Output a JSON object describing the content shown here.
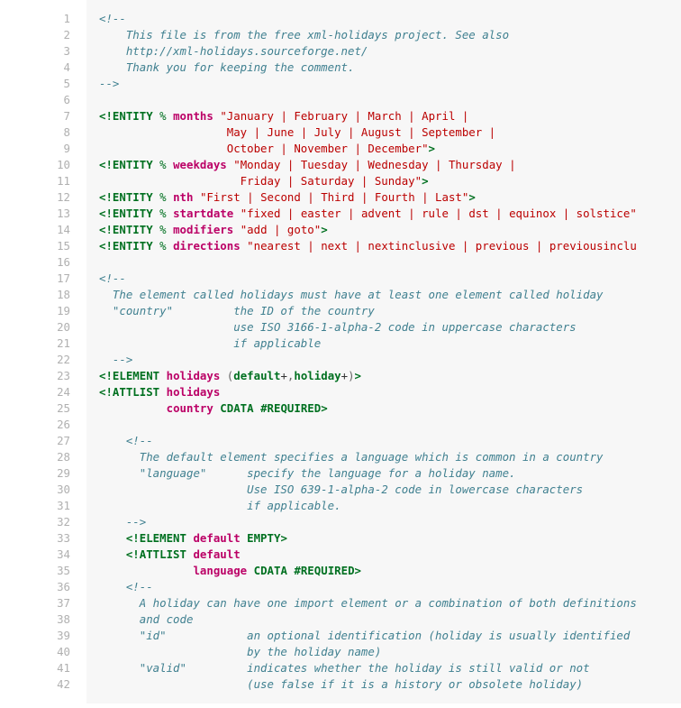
{
  "line_count": 42,
  "lines": [
    {
      "indent": 0,
      "tokens": [
        {
          "cls": "cm",
          "t": "<!--"
        }
      ]
    },
    {
      "indent": 0,
      "tokens": [
        {
          "cls": "cm",
          "t": "    This file is from the free xml-holidays project. See also"
        }
      ]
    },
    {
      "indent": 0,
      "tokens": [
        {
          "cls": "cm",
          "t": "    http://xml-holidays.sourceforge.net/"
        }
      ]
    },
    {
      "indent": 0,
      "tokens": [
        {
          "cls": "cm",
          "t": "    Thank you for keeping the comment."
        }
      ]
    },
    {
      "indent": 0,
      "tokens": [
        {
          "cls": "cm",
          "t": "-->"
        }
      ]
    },
    {
      "indent": 0,
      "tokens": []
    },
    {
      "indent": 0,
      "tokens": [
        {
          "cls": "kw",
          "t": "<!ENTITY "
        },
        {
          "cls": "pd",
          "t": "%"
        },
        {
          "cls": "pl",
          "t": " "
        },
        {
          "cls": "nm",
          "t": "months"
        },
        {
          "cls": "pl",
          "t": " "
        },
        {
          "cls": "st",
          "t": "\"January | February | March | April |"
        }
      ]
    },
    {
      "indent": 0,
      "tokens": [
        {
          "cls": "st",
          "t": "                   May | June | July | August | September |"
        }
      ]
    },
    {
      "indent": 0,
      "tokens": [
        {
          "cls": "st",
          "t": "                   October | November | December\""
        },
        {
          "cls": "kw",
          "t": ">"
        }
      ]
    },
    {
      "indent": 0,
      "tokens": [
        {
          "cls": "kw",
          "t": "<!ENTITY "
        },
        {
          "cls": "pd",
          "t": "%"
        },
        {
          "cls": "pl",
          "t": " "
        },
        {
          "cls": "nm",
          "t": "weekdays"
        },
        {
          "cls": "pl",
          "t": " "
        },
        {
          "cls": "st",
          "t": "\"Monday | Tuesday | Wednesday | Thursday |"
        }
      ]
    },
    {
      "indent": 0,
      "tokens": [
        {
          "cls": "st",
          "t": "                     Friday | Saturday | Sunday\""
        },
        {
          "cls": "kw",
          "t": ">"
        }
      ]
    },
    {
      "indent": 0,
      "tokens": [
        {
          "cls": "kw",
          "t": "<!ENTITY "
        },
        {
          "cls": "pd",
          "t": "%"
        },
        {
          "cls": "pl",
          "t": " "
        },
        {
          "cls": "nm",
          "t": "nth"
        },
        {
          "cls": "pl",
          "t": " "
        },
        {
          "cls": "st",
          "t": "\"First | Second | Third | Fourth | Last\""
        },
        {
          "cls": "kw",
          "t": ">"
        }
      ]
    },
    {
      "indent": 0,
      "tokens": [
        {
          "cls": "kw",
          "t": "<!ENTITY "
        },
        {
          "cls": "pd",
          "t": "%"
        },
        {
          "cls": "pl",
          "t": " "
        },
        {
          "cls": "nm",
          "t": "startdate"
        },
        {
          "cls": "pl",
          "t": " "
        },
        {
          "cls": "st",
          "t": "\"fixed | easter | advent | rule | dst | equinox | solstice\""
        }
      ]
    },
    {
      "indent": 0,
      "tokens": [
        {
          "cls": "kw",
          "t": "<!ENTITY "
        },
        {
          "cls": "pd",
          "t": "%"
        },
        {
          "cls": "pl",
          "t": " "
        },
        {
          "cls": "nm",
          "t": "modifiers"
        },
        {
          "cls": "pl",
          "t": " "
        },
        {
          "cls": "st",
          "t": "\"add | goto\""
        },
        {
          "cls": "kw",
          "t": ">"
        }
      ]
    },
    {
      "indent": 0,
      "tokens": [
        {
          "cls": "kw",
          "t": "<!ENTITY "
        },
        {
          "cls": "pd",
          "t": "%"
        },
        {
          "cls": "pl",
          "t": " "
        },
        {
          "cls": "nm",
          "t": "directions"
        },
        {
          "cls": "pl",
          "t": " "
        },
        {
          "cls": "st",
          "t": "\"nearest | next | nextinclusive | previous | previousinclu"
        }
      ]
    },
    {
      "indent": 0,
      "tokens": []
    },
    {
      "indent": 0,
      "tokens": [
        {
          "cls": "cm",
          "t": "<!--"
        }
      ]
    },
    {
      "indent": 0,
      "tokens": [
        {
          "cls": "cm",
          "t": "  The element called holidays must have at least one element called holiday"
        }
      ]
    },
    {
      "indent": 0,
      "tokens": [
        {
          "cls": "cm",
          "t": "  \"country\"         the ID of the country"
        }
      ]
    },
    {
      "indent": 0,
      "tokens": [
        {
          "cls": "cm",
          "t": "                    use ISO 3166-1-alpha-2 code in uppercase characters"
        }
      ]
    },
    {
      "indent": 0,
      "tokens": [
        {
          "cls": "cm",
          "t": "                    if applicable"
        }
      ]
    },
    {
      "indent": 0,
      "tokens": [
        {
          "cls": "cm",
          "t": "  -->"
        }
      ]
    },
    {
      "indent": 0,
      "tokens": [
        {
          "cls": "kw",
          "t": "<!ELEMENT "
        },
        {
          "cls": "nm",
          "t": "holidays"
        },
        {
          "cls": "pl",
          "t": " "
        },
        {
          "cls": "pg",
          "t": "("
        },
        {
          "cls": "st2",
          "t": "default"
        },
        {
          "cls": "pl",
          "t": "+"
        },
        {
          "cls": "pg",
          "t": ","
        },
        {
          "cls": "st2",
          "t": "holiday"
        },
        {
          "cls": "pl",
          "t": "+"
        },
        {
          "cls": "pg",
          "t": ")"
        },
        {
          "cls": "kw",
          "t": ">"
        }
      ]
    },
    {
      "indent": 0,
      "tokens": [
        {
          "cls": "kw",
          "t": "<!ATTLIST "
        },
        {
          "cls": "nm",
          "t": "holidays"
        }
      ]
    },
    {
      "indent": 0,
      "tokens": [
        {
          "cls": "pl",
          "t": "          "
        },
        {
          "cls": "nm",
          "t": "country"
        },
        {
          "cls": "pl",
          "t": " "
        },
        {
          "cls": "st2",
          "t": "CDATA"
        },
        {
          "cls": "pl",
          "t": " "
        },
        {
          "cls": "st2",
          "t": "#REQUIRED"
        },
        {
          "cls": "kw",
          "t": ">"
        }
      ]
    },
    {
      "indent": 0,
      "tokens": []
    },
    {
      "indent": 1,
      "tokens": [
        {
          "cls": "cm",
          "t": "<!--"
        }
      ]
    },
    {
      "indent": 1,
      "tokens": [
        {
          "cls": "cm",
          "t": "  The default element specifies a language which is common in a country"
        }
      ]
    },
    {
      "indent": 1,
      "tokens": [
        {
          "cls": "cm",
          "t": "  \"language\"      specify the language for a holiday name."
        }
      ]
    },
    {
      "indent": 1,
      "tokens": [
        {
          "cls": "cm",
          "t": "                  Use ISO 639-1-alpha-2 code in lowercase characters"
        }
      ]
    },
    {
      "indent": 1,
      "tokens": [
        {
          "cls": "cm",
          "t": "                  if applicable."
        }
      ]
    },
    {
      "indent": 1,
      "tokens": [
        {
          "cls": "cm",
          "t": "-->"
        }
      ]
    },
    {
      "indent": 1,
      "tokens": [
        {
          "cls": "kw",
          "t": "<!ELEMENT "
        },
        {
          "cls": "nm",
          "t": "default"
        },
        {
          "cls": "pl",
          "t": " "
        },
        {
          "cls": "st2",
          "t": "EMPTY"
        },
        {
          "cls": "kw",
          "t": ">"
        }
      ]
    },
    {
      "indent": 1,
      "tokens": [
        {
          "cls": "kw",
          "t": "<!ATTLIST "
        },
        {
          "cls": "nm",
          "t": "default"
        }
      ]
    },
    {
      "indent": 1,
      "tokens": [
        {
          "cls": "pl",
          "t": "          "
        },
        {
          "cls": "nm",
          "t": "language"
        },
        {
          "cls": "pl",
          "t": " "
        },
        {
          "cls": "st2",
          "t": "CDATA"
        },
        {
          "cls": "pl",
          "t": " "
        },
        {
          "cls": "st2",
          "t": "#REQUIRED"
        },
        {
          "cls": "kw",
          "t": ">"
        }
      ]
    },
    {
      "indent": 1,
      "tokens": [
        {
          "cls": "cm",
          "t": "<!--"
        }
      ]
    },
    {
      "indent": 1,
      "tokens": [
        {
          "cls": "cm",
          "t": "  A holiday can have one import element or a combination of both definitions"
        }
      ]
    },
    {
      "indent": 1,
      "tokens": [
        {
          "cls": "cm",
          "t": "  and code"
        }
      ]
    },
    {
      "indent": 1,
      "tokens": [
        {
          "cls": "cm",
          "t": "  \"id\"            an optional identification (holiday is usually identified"
        }
      ]
    },
    {
      "indent": 1,
      "tokens": [
        {
          "cls": "cm",
          "t": "                  by the holiday name)"
        }
      ]
    },
    {
      "indent": 1,
      "tokens": [
        {
          "cls": "cm",
          "t": "  \"valid\"         indicates whether the holiday is still valid or not"
        }
      ]
    },
    {
      "indent": 1,
      "tokens": [
        {
          "cls": "cm",
          "t": "                  (use false if it is a history or obsolete holiday)"
        }
      ]
    }
  ]
}
